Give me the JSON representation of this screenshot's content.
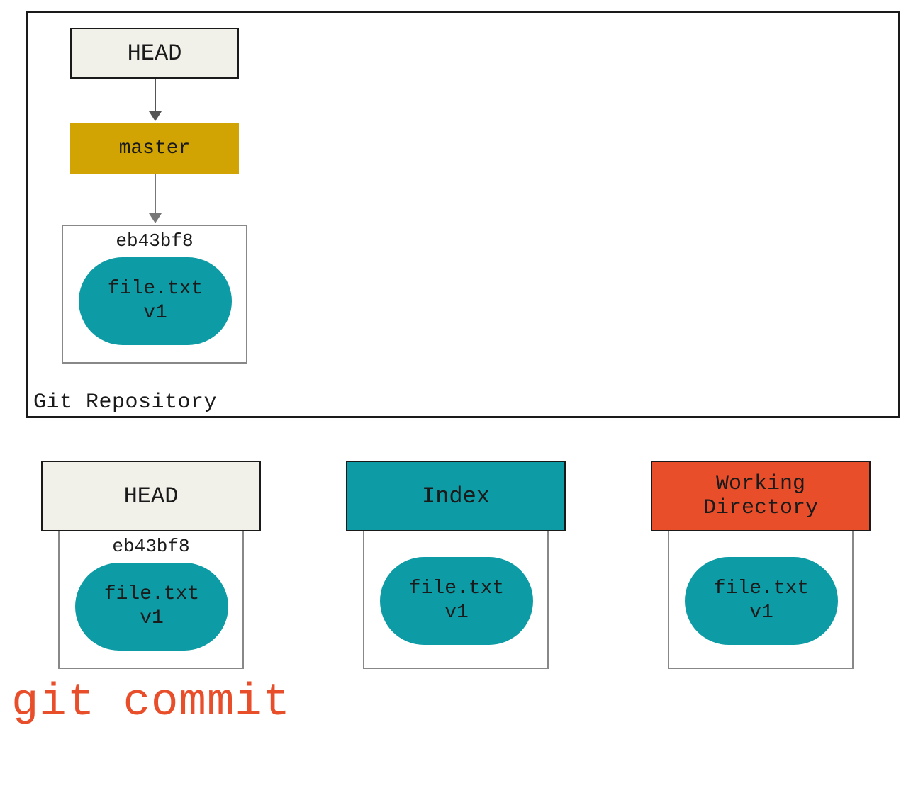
{
  "repository": {
    "label": "Git Repository",
    "head_label": "HEAD",
    "branch_label": "master",
    "commit_hash": "eb43bf8",
    "blob": {
      "filename": "file.txt",
      "version": "v1"
    }
  },
  "columns": {
    "head": {
      "title": "HEAD",
      "commit_hash": "eb43bf8",
      "blob": {
        "filename": "file.txt",
        "version": "v1"
      }
    },
    "index": {
      "title": "Index",
      "blob": {
        "filename": "file.txt",
        "version": "v1"
      }
    },
    "wd": {
      "title_line1": "Working",
      "title_line2": "Directory",
      "blob": {
        "filename": "file.txt",
        "version": "v1"
      }
    }
  },
  "command": "git commit",
  "colors": {
    "cream": "#f1f1ea",
    "gold": "#d1a404",
    "teal": "#0d9ba5",
    "orange": "#e94e2a"
  }
}
